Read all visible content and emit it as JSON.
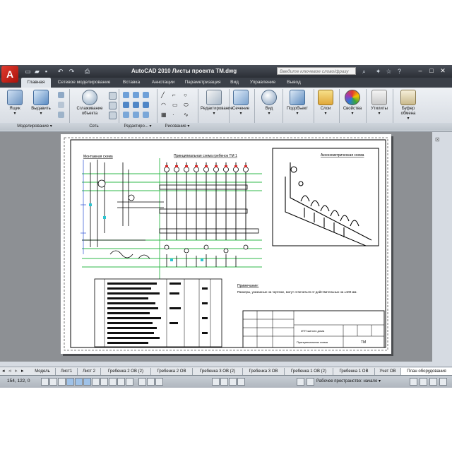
{
  "app": {
    "logo_letter": "A",
    "title": "AutoCAD 2010    Листы проекта ТМ.dwg",
    "search_placeholder": "Введите ключевое слово/фразу"
  },
  "tabs": [
    {
      "label": "Главная",
      "active": true
    },
    {
      "label": "Сетевое моделирование",
      "active": false
    },
    {
      "label": "Вставка",
      "active": false
    },
    {
      "label": "Аннотации",
      "active": false
    },
    {
      "label": "Параметризация",
      "active": false
    },
    {
      "label": "Вид",
      "active": false
    },
    {
      "label": "Управление",
      "active": false
    },
    {
      "label": "Вывод",
      "active": false
    }
  ],
  "ribbon": {
    "buttons": {
      "box": "Ящик",
      "extrude": "Выдавить",
      "smooth": "Сглаживание объекта",
      "edit": "Редактирование",
      "section": "Сечение",
      "view": "Вид",
      "subobject": "Подобъект",
      "layers": "Слои",
      "properties": "Свойства",
      "utilities": "Утилиты",
      "clipboard": "Буфер обмена"
    },
    "groups": {
      "modeling": "Моделирование ▾",
      "mesh": "Сеть",
      "edit": "Редактиро... ▾",
      "draw": "Рисование ▾"
    }
  },
  "drawing": {
    "left_title": "Монтажная схема",
    "top_title": "Принципиальная схема гребенок ТМ 1",
    "iso_title": "Аксонометрическая схема",
    "notes_title": "Примечание:",
    "notes_text": "Размеры, указанные на чертеже, могут отличаться от действительных на ±100 мм.",
    "stamp_lines": [
      "ИТП жилого дома",
      "Принципиальная схема",
      "ТМ"
    ]
  },
  "layout_tabs": [
    {
      "label": "Модель",
      "active": false
    },
    {
      "label": "Лист1",
      "active": false
    },
    {
      "label": "Лист 2",
      "active": false
    },
    {
      "label": "Гребенка 2 ОВ (2)",
      "active": false
    },
    {
      "label": "Гребенка 2 ОВ",
      "active": false
    },
    {
      "label": "Гребенка 3 ОВ (2)",
      "active": false
    },
    {
      "label": "Гребенка 3 ОВ",
      "active": false
    },
    {
      "label": "Гребенка 1 ОВ (2)",
      "active": false
    },
    {
      "label": "Гребенка 1 ОВ",
      "active": false
    },
    {
      "label": "Учет ОВ",
      "active": false
    },
    {
      "label": "План оборудования",
      "active": true
    }
  ],
  "status": {
    "coordinates": "154, 122, 0",
    "workspace": "Рабочее пространство: начало ▾"
  }
}
